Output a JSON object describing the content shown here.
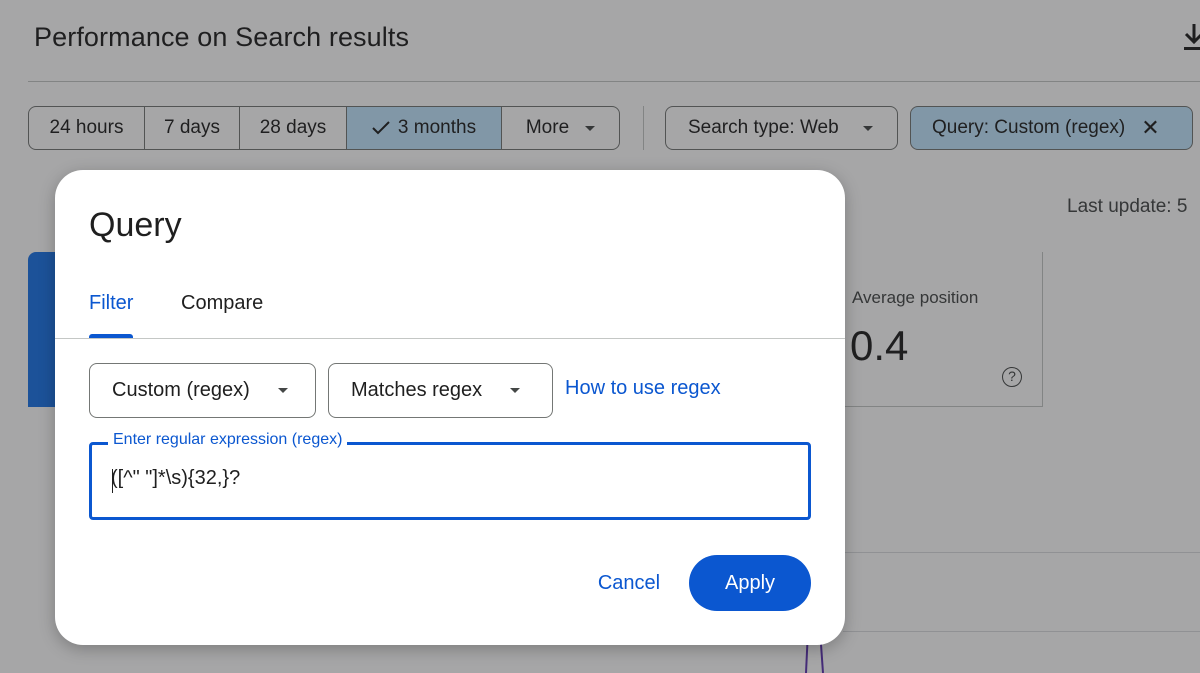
{
  "page": {
    "title": "Performance on Search results",
    "date_ranges": [
      "24 hours",
      "7 days",
      "28 days",
      "3 months",
      "More"
    ],
    "selected_range": "3 months",
    "search_type": "Search type: Web",
    "query_chip": "Query: Custom (regex)",
    "last_update": "Last update: 5",
    "metric_label": "Average position",
    "metric_value": "0.4",
    "help_glyph": "?"
  },
  "dialog": {
    "title": "Query",
    "tabs": [
      "Filter",
      "Compare"
    ],
    "active_tab": "Filter",
    "dimension_dropdown": "Custom (regex)",
    "operator_dropdown": "Matches regex",
    "help_link": "How to use regex",
    "input_label": "Enter regular expression (regex)",
    "input_value": "([^\" \"]*\\s){32,}?",
    "cancel_label": "Cancel",
    "apply_label": "Apply"
  },
  "colors": {
    "accent": "#0b57d0",
    "selected_chip": "#c2e7ff",
    "scrim": "rgba(32,33,36,0.4)"
  },
  "icons": [
    "download-icon",
    "check-icon",
    "chevron-down-icon",
    "close-icon",
    "help-icon"
  ]
}
